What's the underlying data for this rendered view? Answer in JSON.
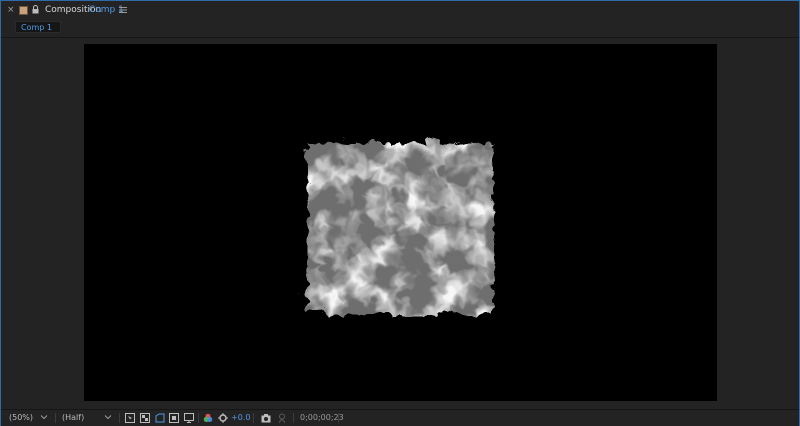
{
  "panel": {
    "title": "Composition",
    "comp_name": "Comp 1",
    "close_glyph": "×"
  },
  "tabs": [
    {
      "label": "Comp 1"
    }
  ],
  "footer": {
    "magnification": "(50%)",
    "resolution": "(Half)",
    "exposure": "+0.0",
    "timecode": "0;00;00;23"
  },
  "colors": {
    "accent": "#4f9ae6",
    "panel_border": "#2f6aa8",
    "background": "#232323"
  },
  "icons": [
    "close-icon",
    "color-label-icon",
    "lock-icon",
    "panel-menu-icon",
    "region-of-interest-icon",
    "transparency-grid-icon",
    "mask-path-icon",
    "safe-margins-icon",
    "3d-view-icon",
    "color-channel-icon",
    "exposure-reset-icon",
    "snapshot-camera-icon",
    "show-snapshot-icon",
    "chevron-down-icon"
  ]
}
